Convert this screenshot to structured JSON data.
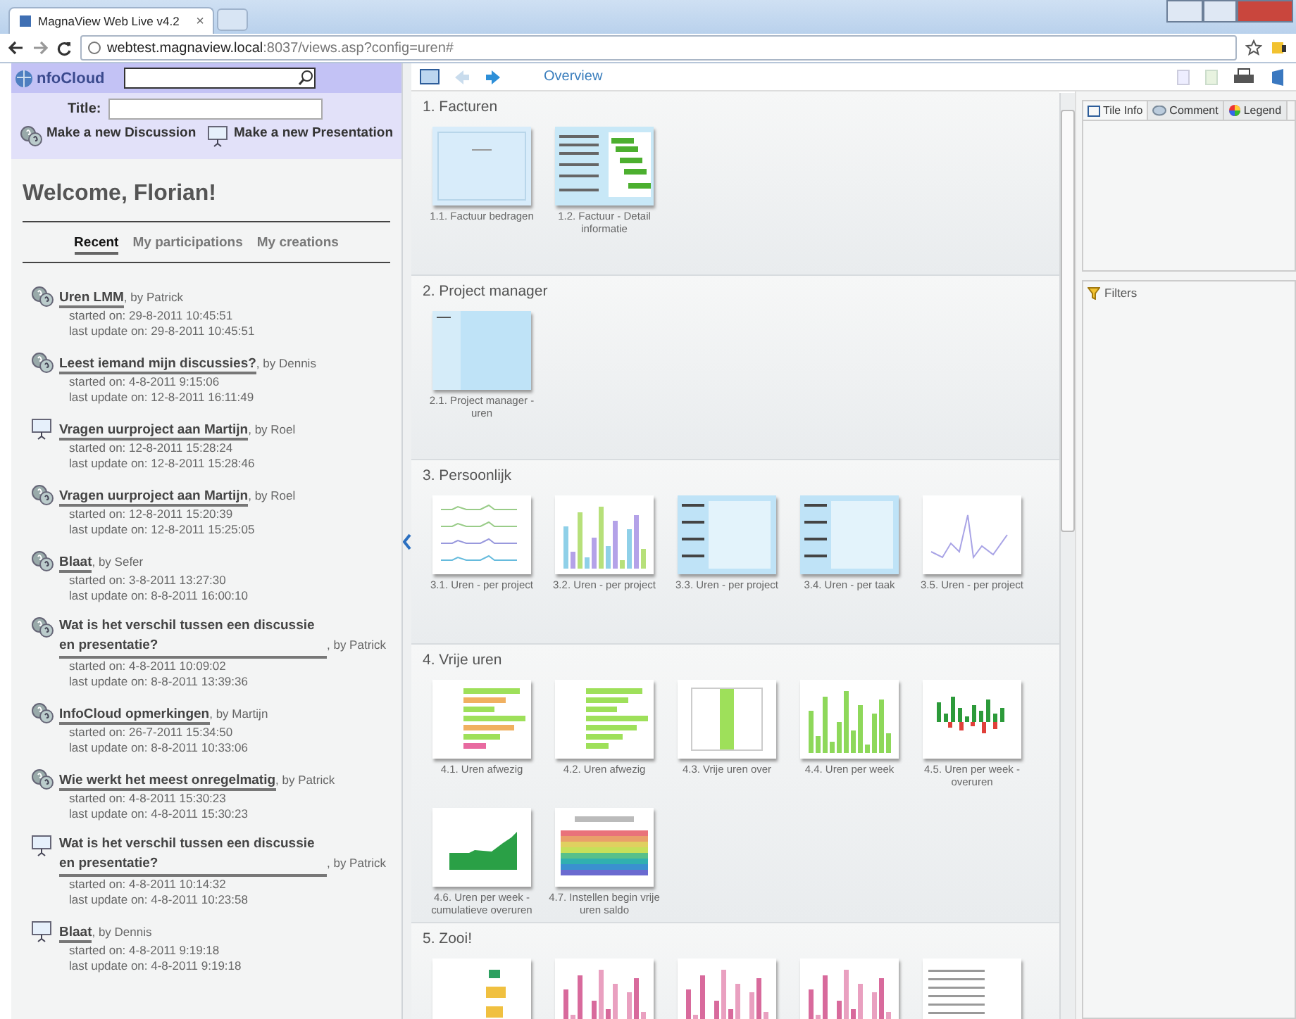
{
  "browser": {
    "tab_title": "MagnaView Web Live v4.2",
    "tab_close": "×",
    "address_host": "webtest.magnaview.local",
    "address_path": ":8037/views.asp?config=uren#"
  },
  "infocloud": {
    "logo": "nfoCloud",
    "title_label": "Title:",
    "actions": [
      {
        "kind": "discussion",
        "label": "Make a new Discussion"
      },
      {
        "kind": "presentation",
        "label": "Make a new Presentation"
      }
    ],
    "welcome": "Welcome, Florian!",
    "tabs": [
      {
        "label": "Recent",
        "selected": true
      },
      {
        "label": "My participations",
        "selected": false
      },
      {
        "label": "My creations",
        "selected": false
      }
    ],
    "items": [
      {
        "kind": "discussion",
        "title": "Uren LMM",
        "author": ", by Patrick",
        "started": "started on: 29-8-2011 10:45:51",
        "updated": "last update on: 29-8-2011 10:45:51"
      },
      {
        "kind": "discussion",
        "title": "Leest iemand mijn discussies?",
        "author": ", by Dennis",
        "started": "started on: 4-8-2011 9:15:06",
        "updated": "last update on: 12-8-2011 16:11:49"
      },
      {
        "kind": "presentation",
        "title": "Vragen uurproject aan Martijn",
        "author": ", by Roel",
        "started": "started on: 12-8-2011 15:28:24",
        "updated": "last update on: 12-8-2011 15:28:46"
      },
      {
        "kind": "discussion",
        "title": "Vragen uurproject aan Martijn",
        "author": ", by Roel",
        "started": "started on: 12-8-2011 15:20:39",
        "updated": "last update on: 12-8-2011 15:25:05"
      },
      {
        "kind": "discussion",
        "title": "Blaat",
        "author": ", by Sefer",
        "started": "started on: 3-8-2011 13:27:30",
        "updated": "last update on: 8-8-2011 16:00:10"
      },
      {
        "kind": "discussion",
        "title": "Wat is het verschil tussen een discussie en presentatie?",
        "author": ", by Patrick",
        "started": "started on: 4-8-2011 10:09:02",
        "updated": "last update on: 8-8-2011 13:39:36"
      },
      {
        "kind": "discussion",
        "title": "InfoCloud opmerkingen",
        "author": ", by Martijn",
        "started": "started on: 26-7-2011 15:34:50",
        "updated": "last update on: 8-8-2011 10:33:06"
      },
      {
        "kind": "discussion",
        "title": "Wie werkt het meest onregelmatig",
        "author": ", by Patrick",
        "started": "started on: 4-8-2011 15:30:23",
        "updated": "last update on: 4-8-2011 15:30:23"
      },
      {
        "kind": "presentation",
        "title": "Wat is het verschil tussen een discussie en presentatie?",
        "author": ", by Patrick",
        "started": "started on: 4-8-2011 10:14:32",
        "updated": "last update on: 4-8-2011 10:23:58"
      },
      {
        "kind": "presentation",
        "title": "Blaat",
        "author": ", by Dennis",
        "started": "started on: 4-8-2011 9:19:18",
        "updated": "last update on: 4-8-2011 9:19:18"
      }
    ]
  },
  "toolbar": {
    "back_disabled": true,
    "forward_disabled": false,
    "breadcrumb": "Overview"
  },
  "sections": [
    {
      "title": "1. Facturen",
      "tiles": [
        {
          "kind": "picture",
          "caption": "1.1. Factuur bedragen"
        },
        {
          "kind": "picture",
          "caption": "1.2. Factuur - Detail informatie"
        }
      ]
    },
    {
      "title": "2. Project manager",
      "tiles": [
        {
          "kind": "picture",
          "caption": "2.1. Project manager - uren"
        }
      ]
    },
    {
      "title": "3. Persoonlijk",
      "tiles": [
        {
          "kind": "picture",
          "caption": "3.1. Uren - per project"
        },
        {
          "kind": "picture",
          "caption": "3.2. Uren - per project"
        },
        {
          "kind": "picture",
          "caption": "3.3. Uren - per project"
        },
        {
          "kind": "picture",
          "caption": "3.4. Uren - per taak"
        },
        {
          "kind": "picture",
          "caption": "3.5. Uren - per project"
        }
      ]
    },
    {
      "title": "4. Vrije uren",
      "tiles": [
        {
          "kind": "picture",
          "caption": "4.1. Uren afwezig"
        },
        {
          "kind": "picture",
          "caption": "4.2. Uren afwezig"
        },
        {
          "kind": "picture",
          "caption": "4.3. Vrije uren over"
        },
        {
          "kind": "picture",
          "caption": "4.4. Uren per week"
        },
        {
          "kind": "picture",
          "caption": "4.5. Uren per week - overuren"
        },
        {
          "kind": "picture",
          "caption": "4.6. Uren per week - cumulatieve overuren"
        },
        {
          "kind": "picture",
          "caption": "4.7. Instellen begin vrije uren saldo"
        }
      ]
    },
    {
      "title": "5. Zooi!"
    }
  ],
  "side_tabs": [
    {
      "label": "Tile Info",
      "selected": true
    },
    {
      "label": "Comment",
      "selected": false
    },
    {
      "label": "Legend",
      "selected": false
    }
  ],
  "filters": {
    "title": "Filters"
  }
}
